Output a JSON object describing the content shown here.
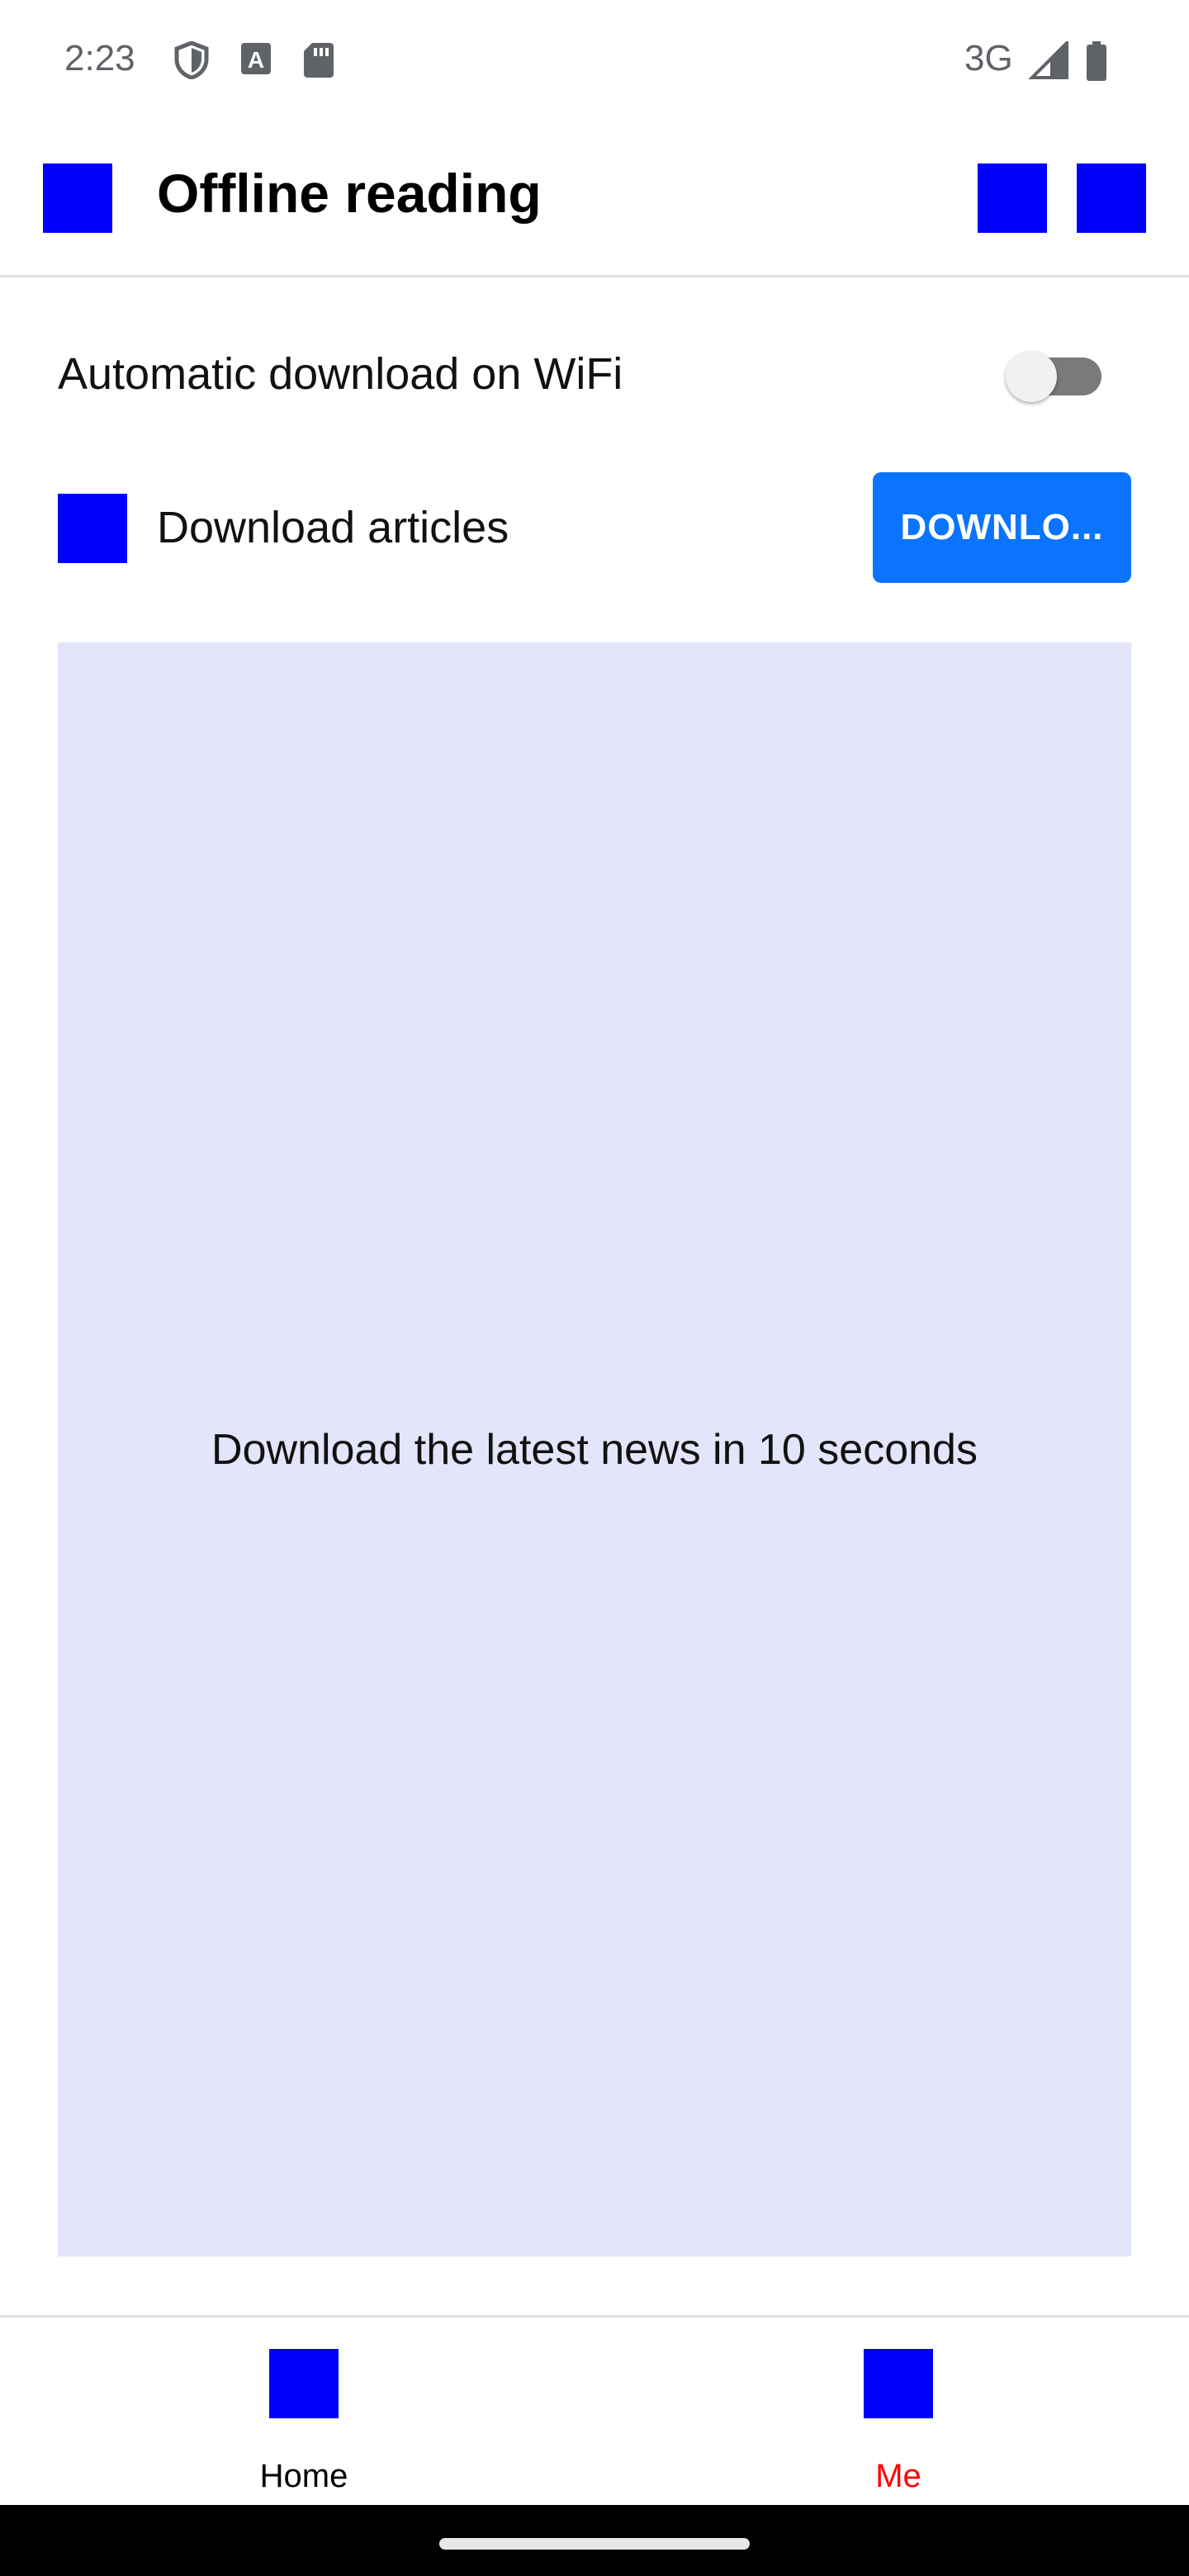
{
  "status_bar": {
    "time": "2:23",
    "network": "3G",
    "icons": [
      "shield-icon",
      "font-a-icon",
      "sd-card-icon",
      "signal-icon",
      "battery-icon"
    ]
  },
  "app_bar": {
    "title": "Offline reading",
    "icons": [
      "app-bar-nav-icon",
      "app-bar-action-icon-1",
      "app-bar-action-icon-2"
    ]
  },
  "settings": {
    "auto_download_label": "Automatic download on WiFi",
    "auto_download_enabled": false,
    "download_articles_label": "Download articles",
    "download_button_label": "DOWNLO..."
  },
  "info_panel": {
    "text": "Download the latest news in 10 seconds"
  },
  "bottom_nav": {
    "items": [
      {
        "label": "Home",
        "icon": "home-icon",
        "selected": false
      },
      {
        "label": "Me",
        "icon": "me-icon",
        "selected": true
      }
    ]
  },
  "colors": {
    "placeholder_icon": "#0000ff",
    "primary_button": "#0a74ff",
    "panel_background": "#e4e4fb",
    "selected_nav": "#ff0000"
  }
}
